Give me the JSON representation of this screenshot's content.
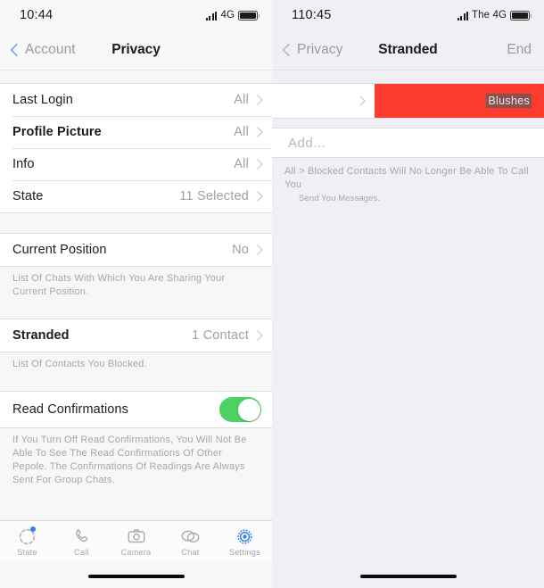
{
  "left_screen": {
    "status_bar": {
      "time": "10:44",
      "network": "4G",
      "signal_icon": "signal-bars-icon",
      "battery_icon": "battery-icon"
    },
    "nav": {
      "back_label": "Account",
      "title": "Privacy",
      "back_icon": "chevron-left-icon"
    },
    "group_1": {
      "rows": [
        {
          "label": "Last Login",
          "value": "All",
          "chevron": "chevron-right-icon"
        },
        {
          "label": "Profile Picture",
          "value": "All",
          "chevron": "chevron-right-icon"
        },
        {
          "label": "Info",
          "value": "All",
          "chevron": "chevron-right-icon"
        },
        {
          "label": "State",
          "value": "11 Selected",
          "chevron": "chevron-right-icon"
        }
      ]
    },
    "group_2": {
      "rows": [
        {
          "label": "Current Position",
          "value": "No",
          "chevron": "chevron-right-icon"
        }
      ],
      "note": "List Of Chats With Which You Are Sharing Your Current Position."
    },
    "group_3": {
      "rows": [
        {
          "label": "Stranded",
          "value": "1 Contact",
          "chevron": "chevron-right-icon"
        }
      ],
      "note": "List Of Contacts You Blocked."
    },
    "group_4": {
      "rows": [
        {
          "label": "Read Confirmations",
          "toggle": "on"
        }
      ],
      "note": "If You Turn Off Read Confirmations, You Will Not Be Able To See The Read Confirmations Of Other Pepole. The Confirmations Of Readings Are Always Sent For Group Chats."
    },
    "tabbar": {
      "tabs": [
        {
          "label": "State",
          "icon": "state-dashed-circle-icon",
          "badge": true,
          "active": false
        },
        {
          "label": "Call",
          "icon": "phone-handset-icon",
          "badge": false,
          "active": false
        },
        {
          "label": "Camera",
          "icon": "camera-icon",
          "badge": false,
          "active": false
        },
        {
          "label": "Chat",
          "icon": "chat-bubbles-icon",
          "badge": false,
          "active": false
        },
        {
          "label": "Settings",
          "icon": "gear-icon",
          "badge": false,
          "active": true
        }
      ]
    }
  },
  "right_screen": {
    "status_bar": {
      "time": "110:45",
      "network": "The 4G",
      "signal_icon": "signal-bars-icon",
      "battery_icon": "battery-icon"
    },
    "nav": {
      "back_label": "Privacy",
      "title": "Stranded",
      "right_label": "End",
      "back_icon": "chevron-left-icon"
    },
    "swipe_row": {
      "delete_label": "Blushes",
      "chevron": "chevron-right-icon"
    },
    "add_row": {
      "label": "Add..."
    },
    "note_line_1": "All > Blocked Contacts Will No Longer Be Able To Call You",
    "note_line_2": "Send You Messages."
  },
  "colors": {
    "accent_blue": "#2f80ed",
    "destructive_red": "#fb3b2e",
    "toggle_green": "#4cd263",
    "background_gray": "#efeff4",
    "secondary_text": "#a0a0a5"
  }
}
